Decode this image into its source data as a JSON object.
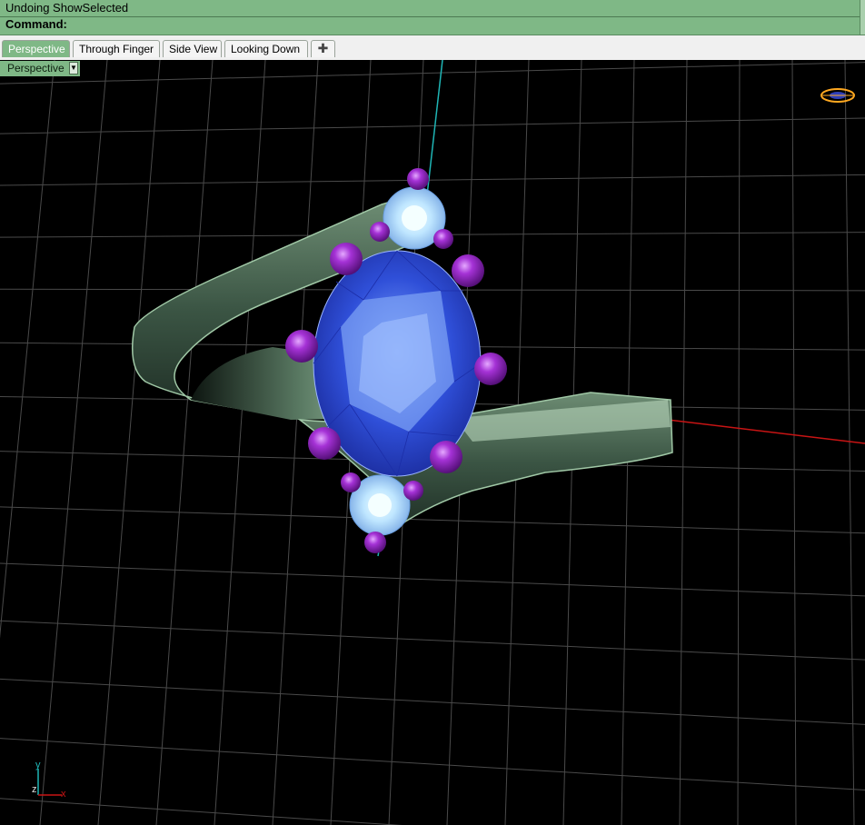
{
  "command": {
    "history_line": "Undoing ShowSelected",
    "prompt": "Command:"
  },
  "tabs": [
    {
      "label": "Perspective",
      "active": true
    },
    {
      "label": "Through Finger",
      "active": false
    },
    {
      "label": "Side View",
      "active": false
    },
    {
      "label": "Looking Down",
      "active": false
    }
  ],
  "add_tab_icon": "plus-icon",
  "viewport": {
    "label": "Perspective",
    "dropdown_icon": "chevron-down-icon"
  },
  "axis_widget": {
    "y_label": "y",
    "z_label": "z",
    "x_label": "x"
  },
  "colors": {
    "command_bg": "#7fb886",
    "grid": "#505050",
    "x_axis": "#d01010",
    "y_axis": "#1fb5b5",
    "band": "#3f5a48",
    "gem_main": "#2a44c8",
    "gem_small": "#bfe8ff",
    "prong": "#8a1fb0"
  }
}
